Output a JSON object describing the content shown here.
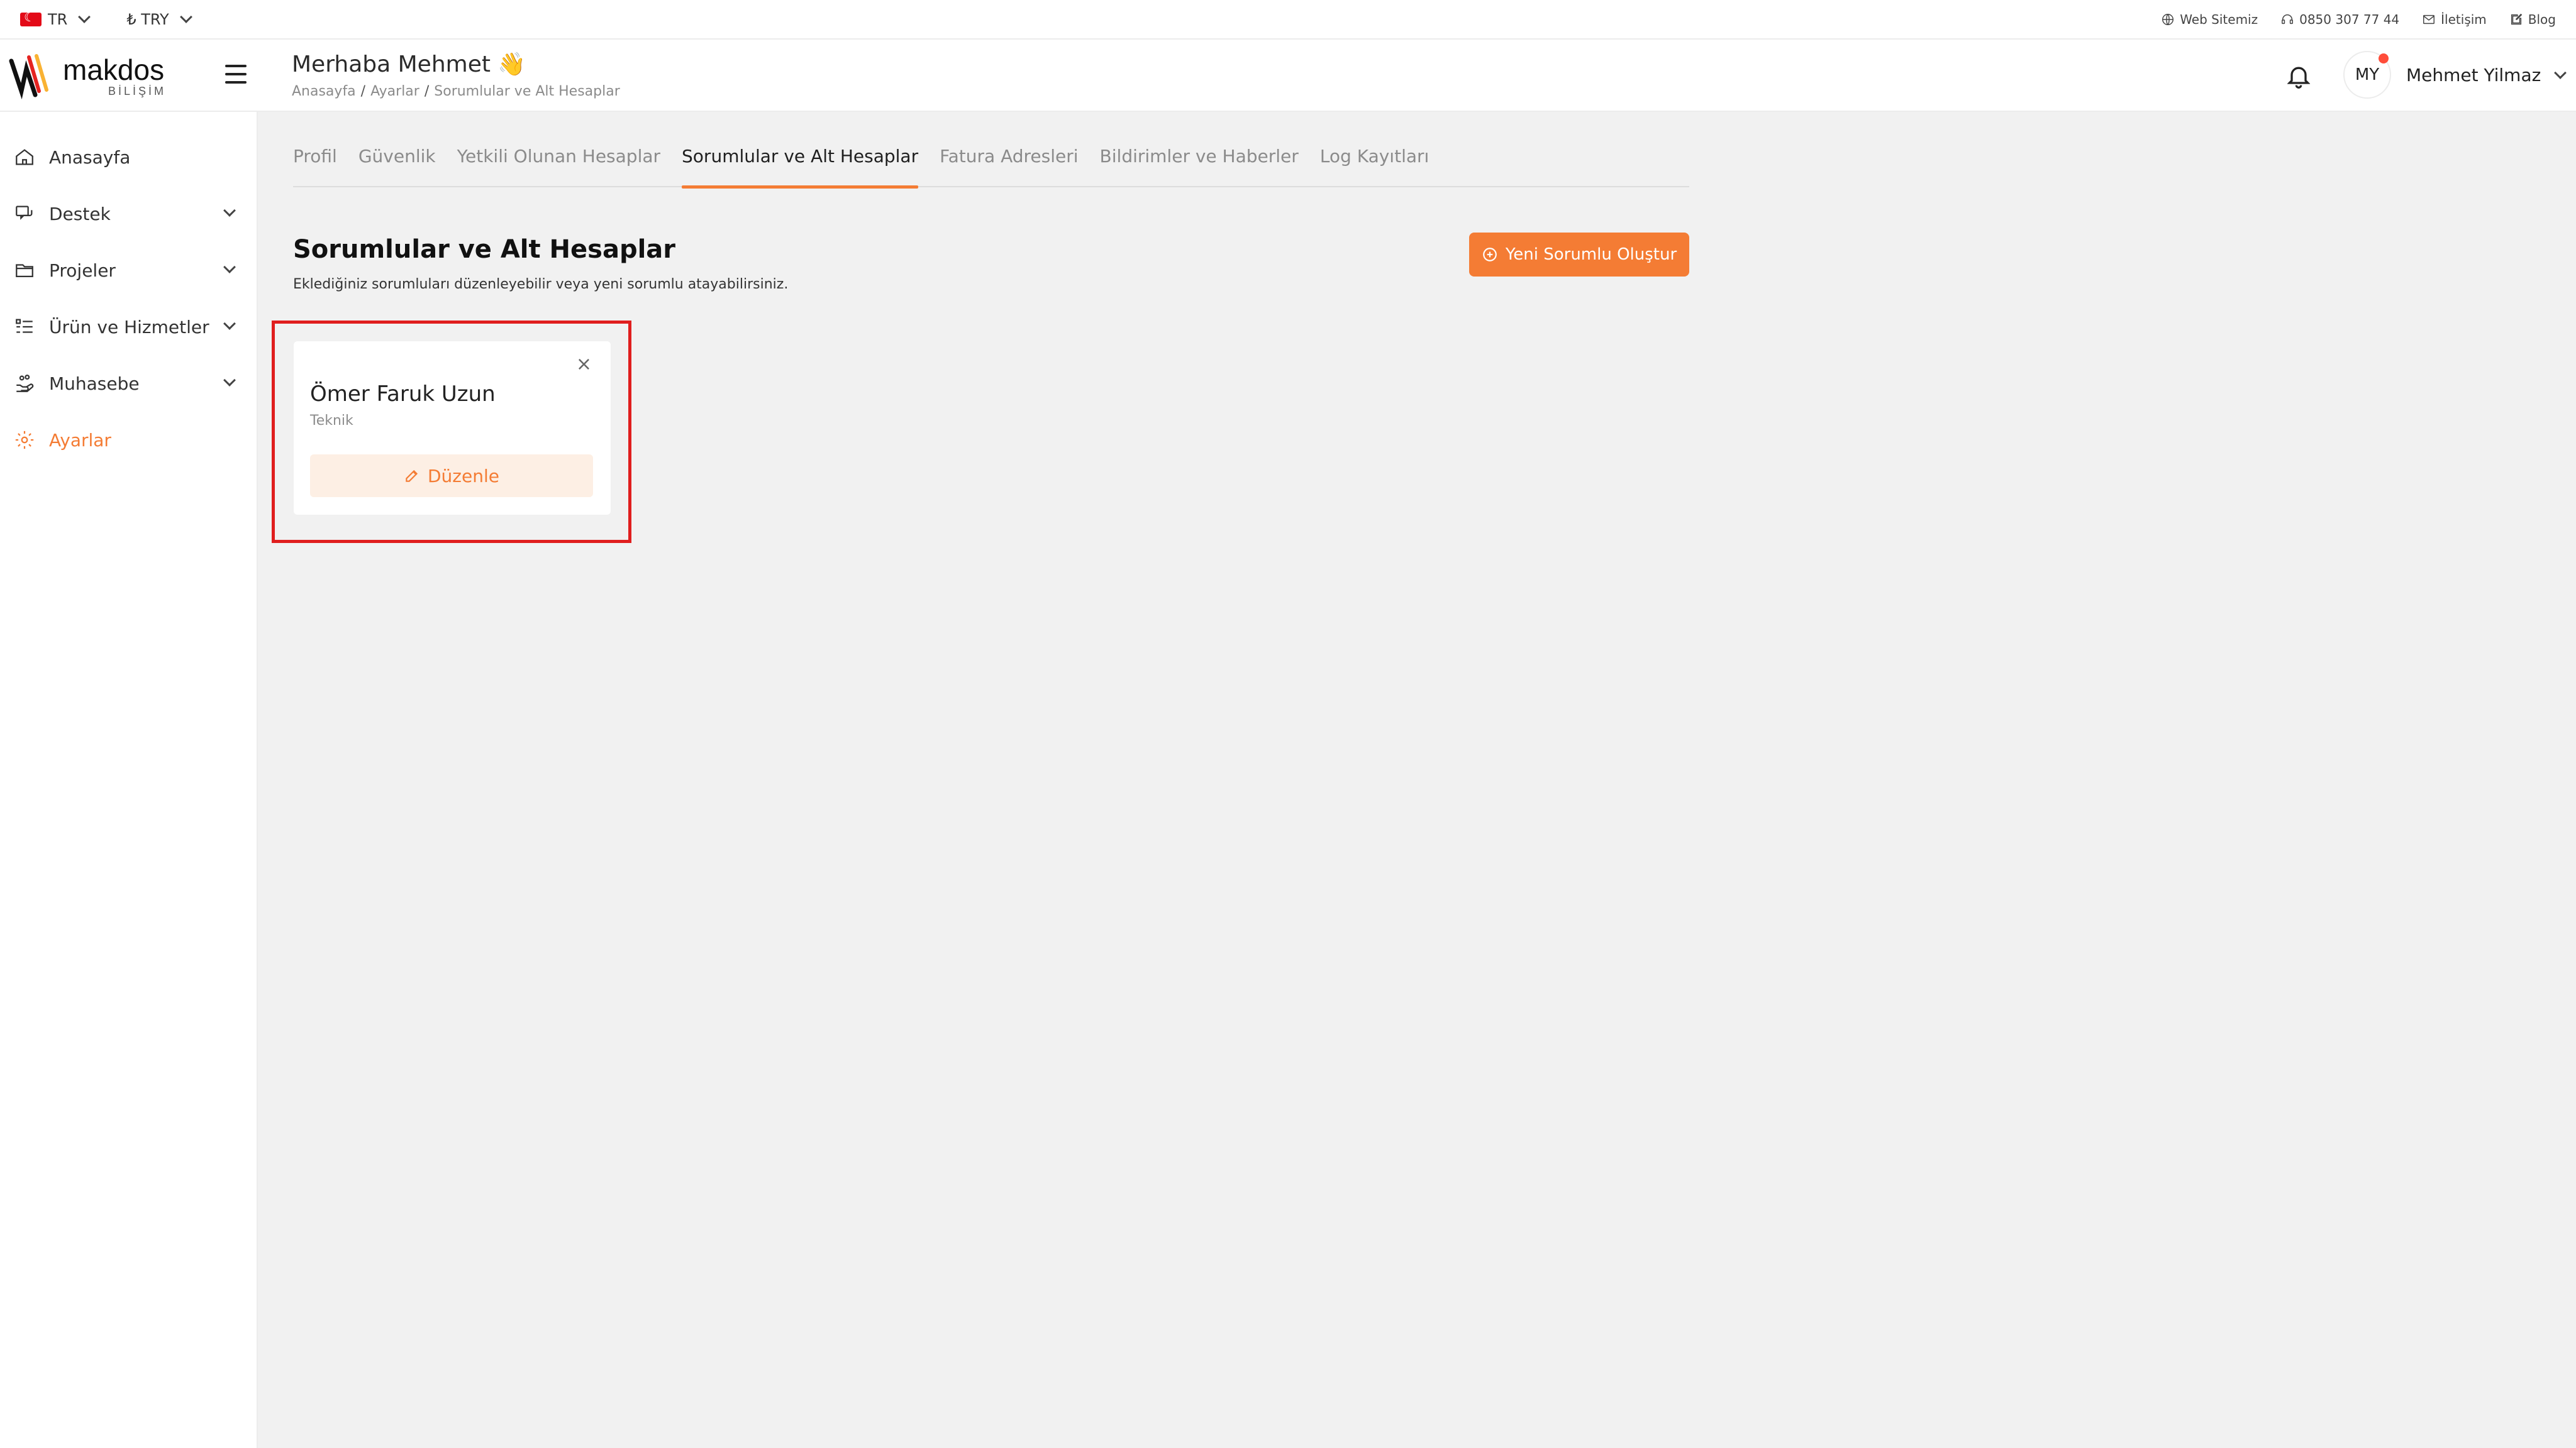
{
  "topbar": {
    "language": "TR",
    "currency": "₺ TRY",
    "links": {
      "website": "Web Sitemiz",
      "phone": "0850 307 77 44",
      "contact": "İletişim",
      "blog": "Blog"
    }
  },
  "header": {
    "greeting": "Merhaba Mehmet 👋",
    "breadcrumb": [
      "Anasayfa",
      "Ayarlar",
      "Sorumlular ve Alt Hesaplar"
    ],
    "avatar_initials": "MY",
    "user_name": "Mehmet Yilmaz"
  },
  "logo": {
    "brand": "makdos",
    "sub": "BİLİŞİM"
  },
  "sidebar": {
    "items": [
      {
        "label": "Anasayfa"
      },
      {
        "label": "Destek"
      },
      {
        "label": "Projeler"
      },
      {
        "label": "Ürün ve Hizmetler"
      },
      {
        "label": "Muhasebe"
      },
      {
        "label": "Ayarlar"
      }
    ]
  },
  "tabs": [
    "Profil",
    "Güvenlik",
    "Yetkili Olunan Hesaplar",
    "Sorumlular ve Alt Hesaplar",
    "Fatura Adresleri",
    "Bildirimler ve Haberler",
    "Log Kayıtları"
  ],
  "section": {
    "title": "Sorumlular ve Alt Hesaplar",
    "description": "Eklediğiniz sorumluları düzenleyebilir veya yeni sorumlu atayabilirsiniz.",
    "new_button": "Yeni Sorumlu Oluştur"
  },
  "card": {
    "name": "Ömer Faruk Uzun",
    "role": "Teknik",
    "edit_label": "Düzenle",
    "close_glyph": "×"
  },
  "colors": {
    "accent": "#f47c34",
    "highlight": "#e01e1e"
  }
}
